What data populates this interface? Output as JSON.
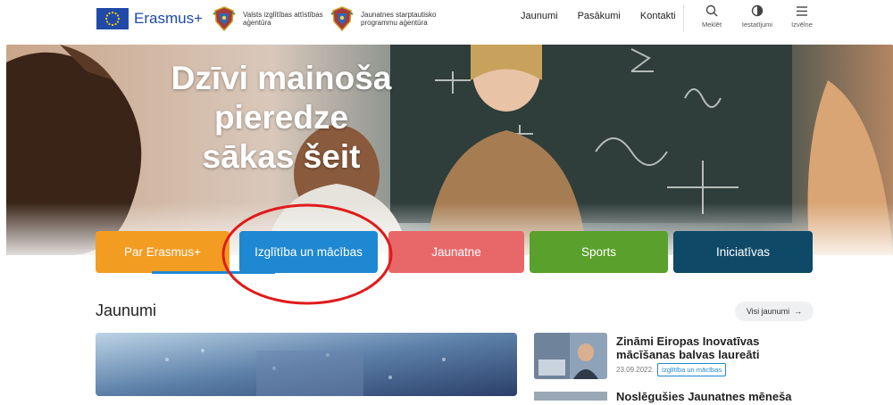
{
  "header": {
    "brand": "Erasmus+",
    "agency1": "Valsts izglītības attīstības aģentūra",
    "agency2": "Jaunatnes starptautisko programmu aģentūra",
    "nav": [
      "Jaunumi",
      "Pasākumi",
      "Kontakti"
    ],
    "tools": [
      {
        "label": "Meklēt",
        "icon": "search-icon"
      },
      {
        "label": "Iestatījumi",
        "icon": "contrast-icon"
      },
      {
        "label": "Izvēlne",
        "icon": "menu-icon"
      }
    ]
  },
  "hero": {
    "line1": "Dzīvi mainoša pieredze",
    "line2": "sākas šeit"
  },
  "categories": [
    {
      "label": "Par Erasmus+",
      "color": "#f39c22"
    },
    {
      "label": "Izglītība un mācības",
      "color": "#1e88d2"
    },
    {
      "label": "Jaunatne",
      "color": "#e8686a"
    },
    {
      "label": "Sports",
      "color": "#5aa02c"
    },
    {
      "label": "Iniciatīvas",
      "color": "#0e4967"
    }
  ],
  "news": {
    "title": "Jaunumi",
    "all_label": "Visi jaunumi",
    "items": [
      {
        "headline": "Zināmi Eiropas Inovatīvas mācīšanas balvas laureāti",
        "date": "23.09.2022.",
        "tag": "Izglītība un mācības"
      },
      {
        "headline": "Noslēgušies Jaunatnes mēneša"
      }
    ]
  }
}
